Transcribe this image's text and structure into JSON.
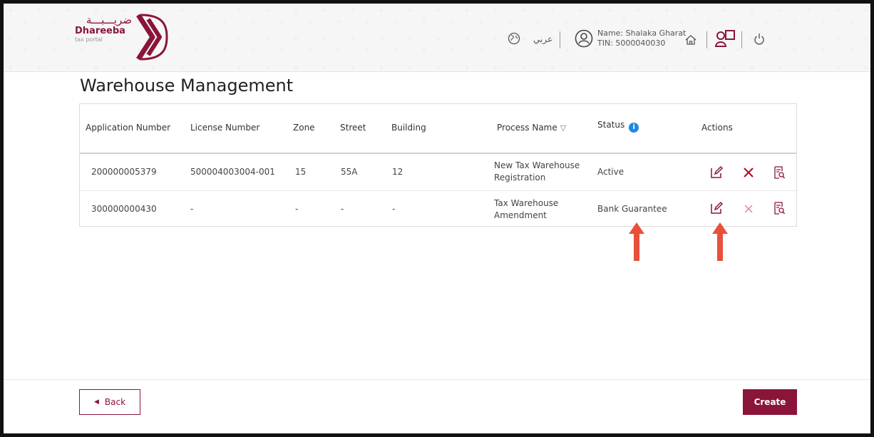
{
  "logo": {
    "arabic": "ضريـــبـــة",
    "name": "Dhareeba",
    "subtitle": "tax portal"
  },
  "header": {
    "language_label": "عربي",
    "user_name": "Name: Shalaka Gharat",
    "user_tin": "TIN: 5000040030"
  },
  "page": {
    "title": "Warehouse Management"
  },
  "table": {
    "columns": {
      "application_number": "Application Number",
      "license_number": "License Number",
      "zone": "Zone",
      "street": "Street",
      "building": "Building",
      "process_name": "Process Name",
      "status": "Status",
      "actions": "Actions"
    },
    "rows": [
      {
        "application_number": "200000005379",
        "license_number": "500004003004-001",
        "zone": "15",
        "street": "55A",
        "building": "12",
        "process_name": "New Tax Warehouse Registration",
        "status": "Active"
      },
      {
        "application_number": "300000000430",
        "license_number": "-",
        "zone": "-",
        "street": "-",
        "building": "-",
        "process_name": "Tax Warehouse Amendment",
        "status": "Bank Guarantee"
      }
    ]
  },
  "footer": {
    "back_label": "Back",
    "create_label": "Create"
  },
  "colors": {
    "brand": "#8a1538",
    "info": "#1e88e5",
    "annotation_arrow": "#e8503a"
  },
  "icons": [
    "globe-icon",
    "user-icon",
    "home-icon",
    "help-icon",
    "power-icon",
    "edit-icon",
    "delete-icon",
    "view-details-icon",
    "filter-icon",
    "info-icon",
    "back-arrow-icon"
  ]
}
